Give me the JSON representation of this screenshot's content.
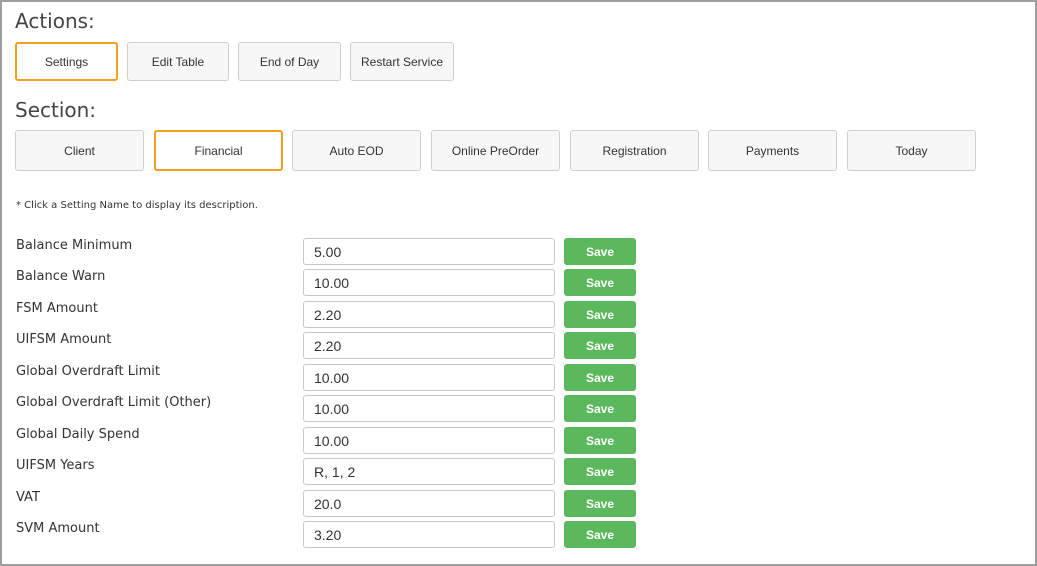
{
  "actions": {
    "heading": "Actions:",
    "buttons": [
      {
        "label": "Settings"
      },
      {
        "label": "Edit Table"
      },
      {
        "label": "End of Day"
      },
      {
        "label": "Restart Service"
      }
    ]
  },
  "section": {
    "heading": "Section:",
    "tabs": [
      {
        "label": "Client"
      },
      {
        "label": "Financial"
      },
      {
        "label": "Auto EOD"
      },
      {
        "label": "Online PreOrder"
      },
      {
        "label": "Registration"
      },
      {
        "label": "Payments"
      },
      {
        "label": "Today"
      }
    ]
  },
  "note": "* Click a Setting Name to display its description.",
  "settings": [
    {
      "name": "Balance Minimum",
      "value": "5.00",
      "save": "Save"
    },
    {
      "name": "Balance Warn",
      "value": "10.00",
      "save": "Save"
    },
    {
      "name": "FSM Amount",
      "value": "2.20",
      "save": "Save"
    },
    {
      "name": "UIFSM Amount",
      "value": "2.20",
      "save": "Save"
    },
    {
      "name": "Global Overdraft Limit",
      "value": "10.00",
      "save": "Save"
    },
    {
      "name": "Global Overdraft Limit (Other)",
      "value": "10.00",
      "save": "Save"
    },
    {
      "name": "Global Daily Spend",
      "value": "10.00",
      "save": "Save"
    },
    {
      "name": "UIFSM Years",
      "value": "R, 1, 2",
      "save": "Save"
    },
    {
      "name": "VAT",
      "value": "20.0",
      "save": "Save"
    },
    {
      "name": "SVM Amount",
      "value": "3.20",
      "save": "Save"
    }
  ],
  "colors": {
    "active_border": "#f0a01c",
    "save_button": "#5cb85c"
  }
}
